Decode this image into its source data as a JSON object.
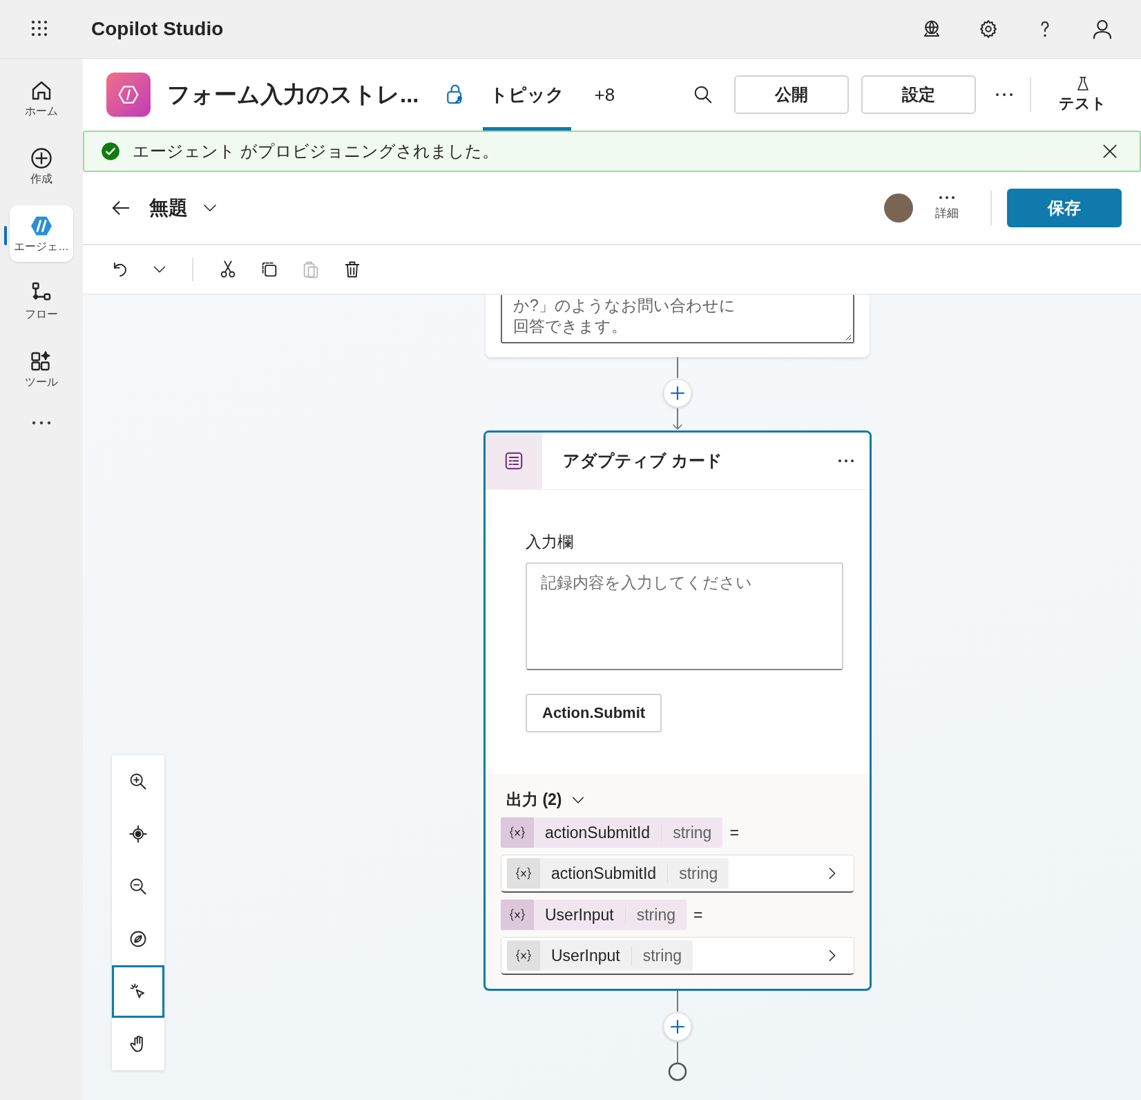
{
  "app_bar": {
    "title": "Copilot Studio"
  },
  "sidebar": {
    "items": [
      {
        "kind": "home",
        "label": "ホーム",
        "selected": false
      },
      {
        "kind": "create",
        "label": "作成",
        "selected": false
      },
      {
        "kind": "agent",
        "label": "エージェ…",
        "selected": true
      },
      {
        "kind": "flow",
        "label": "フロー",
        "selected": false
      },
      {
        "kind": "tools",
        "label": "ツール",
        "selected": false
      }
    ]
  },
  "agent_header": {
    "name": "フォーム入力のストレ...",
    "tabs": [
      {
        "label": "トピック",
        "selected": true
      },
      {
        "label": "+8",
        "selected": false
      }
    ],
    "buttons": [
      "公開",
      "設定"
    ],
    "test_label": "テスト"
  },
  "banner": {
    "message": "エージェント がプロビジョニングされました。"
  },
  "topic_bar": {
    "title": "無題",
    "details_label": "詳細",
    "save_label": "保存"
  },
  "toolbar": [
    {
      "kind": "undo",
      "disabled": false
    },
    {
      "kind": "cut",
      "disabled": false
    },
    {
      "kind": "copy",
      "disabled": false
    },
    {
      "kind": "paste",
      "disabled": true
    },
    {
      "kind": "delete",
      "disabled": false
    }
  ],
  "canvas": {
    "previous_node_text": "か?」のようなお問い合わせに回答できます。",
    "node": {
      "title": "アダプティブ カード",
      "field_label": "入力欄",
      "placeholder": "記録内容を入力してください",
      "submit_label": "Action.Submit",
      "outputs_heading": "出力 (2)",
      "outputs_expanded": true,
      "outputs": [
        {
          "name": "actionSubmitId",
          "type": "string",
          "operator": "=",
          "value": {
            "name": "actionSubmitId",
            "type": "string"
          }
        },
        {
          "name": "UserInput",
          "type": "string",
          "operator": "=",
          "value": {
            "name": "UserInput",
            "type": "string"
          }
        }
      ]
    }
  },
  "zoom_controls": [
    {
      "kind": "zoom-in",
      "selected": false
    },
    {
      "kind": "recenter",
      "selected": false
    },
    {
      "kind": "zoom-out",
      "selected": false
    },
    {
      "kind": "minimap",
      "selected": false
    },
    {
      "kind": "select",
      "selected": true
    },
    {
      "kind": "pan",
      "selected": false
    }
  ]
}
